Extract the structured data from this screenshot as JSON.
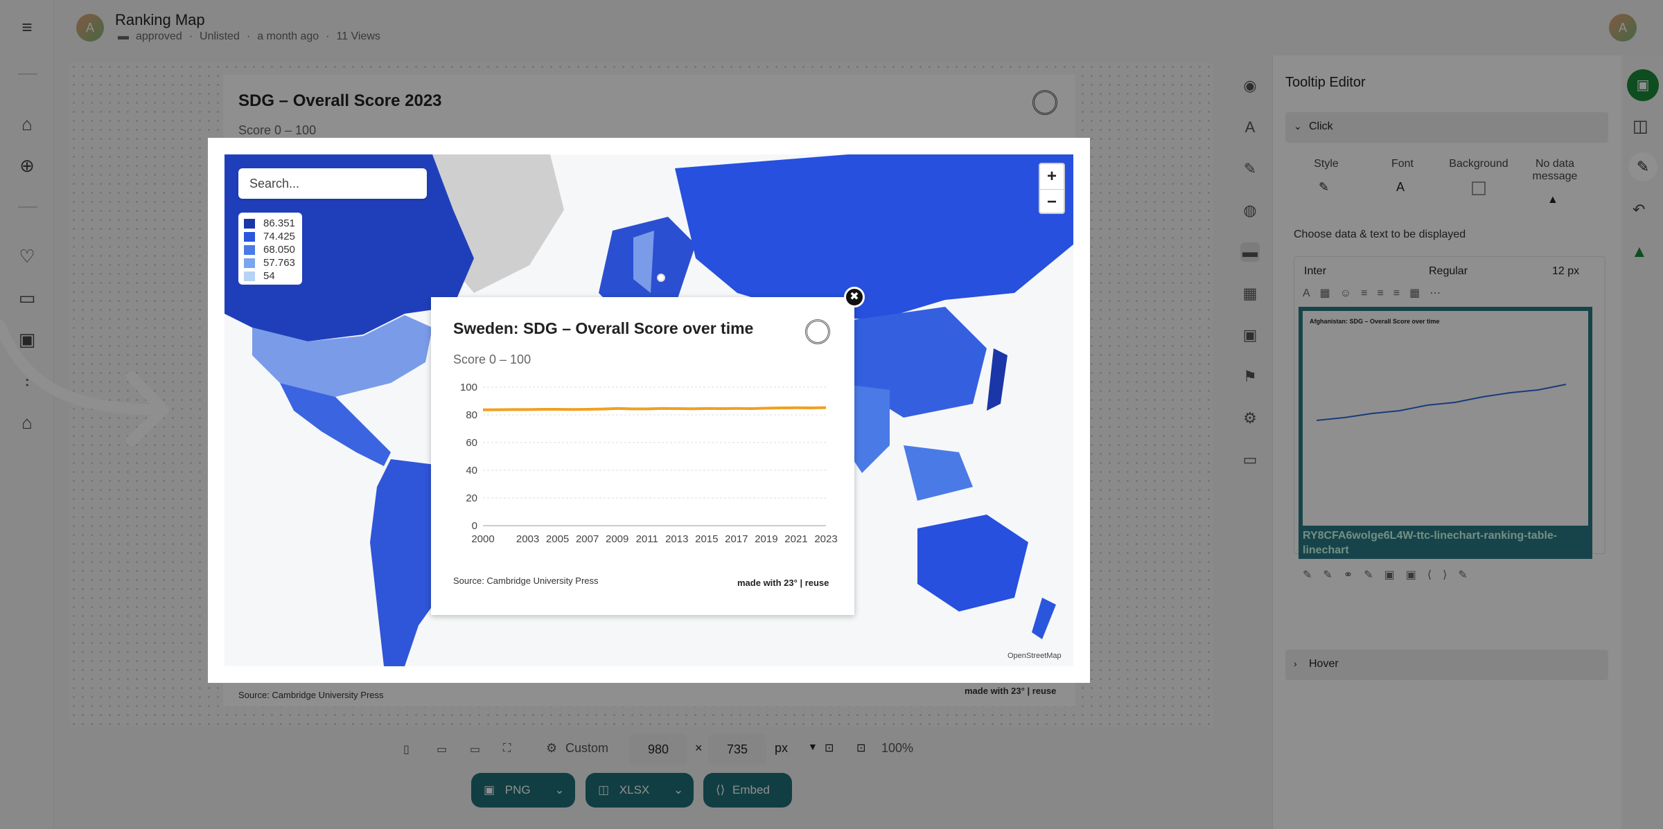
{
  "app": {
    "title": "Ranking Map",
    "folder": "approved",
    "visibility": "Unlisted",
    "time": "a month ago",
    "views": "11 Views",
    "avatar_letter": "A"
  },
  "card": {
    "title": "SDG – Overall Score 2023",
    "subtitle": "Score 0 – 100",
    "source": "Source: Cambridge University Press",
    "made_with": "made with 23° | reuse"
  },
  "map": {
    "search_placeholder": "Search...",
    "zoom_in": "+",
    "zoom_out": "−",
    "attribution": "OpenStreetMap",
    "legend": [
      {
        "label": "86.351",
        "color": "#1a36a8"
      },
      {
        "label": "74.425",
        "color": "#2a55dd"
      },
      {
        "label": "68.050",
        "color": "#4a7ae6"
      },
      {
        "label": "57.763",
        "color": "#7aa6f0"
      },
      {
        "label": "54",
        "color": "#b6d2f6"
      }
    ]
  },
  "tooltip": {
    "title": "Sweden: SDG – Overall Score over time",
    "subtitle": "Score 0 – 100",
    "source": "Source: Cambridge University Press",
    "made_with": "made with 23° | reuse",
    "close": "✖"
  },
  "chart_data": {
    "type": "line",
    "title": "Sweden: SDG – Overall Score over time",
    "subtitle": "Score 0 – 100",
    "x_ticks": [
      "2000",
      "2003",
      "2005",
      "2007",
      "2009",
      "2011",
      "2013",
      "2015",
      "2017",
      "2019",
      "2021",
      "2023"
    ],
    "y_ticks": [
      "100",
      "80",
      "60",
      "40",
      "20",
      "0"
    ],
    "ylim": [
      0,
      100
    ],
    "xlim": [
      2000,
      2023
    ],
    "grid": true,
    "series": [
      {
        "color": "#f0a020",
        "x": [
          2000,
          2001,
          2002,
          2003,
          2004,
          2005,
          2006,
          2007,
          2008,
          2009,
          2010,
          2011,
          2012,
          2013,
          2014,
          2015,
          2016,
          2017,
          2018,
          2019,
          2020,
          2021,
          2022,
          2023
        ],
        "y": [
          83.6,
          83.7,
          83.8,
          83.8,
          84.0,
          84.0,
          83.9,
          84.0,
          84.2,
          84.6,
          84.3,
          84.3,
          84.6,
          84.5,
          84.4,
          84.6,
          84.5,
          84.6,
          84.5,
          84.8,
          85.0,
          85.1,
          85.0,
          85.2
        ]
      }
    ]
  },
  "panel": {
    "title": "Tooltip Editor",
    "section_click": "Click",
    "opt_style": "Style",
    "opt_font": "Font",
    "opt_background": "Background",
    "opt_nodata": "No data message",
    "choose_label": "Choose data & text to be displayed",
    "font_family": "Inter",
    "font_weight": "Regular",
    "font_size": "12 px",
    "preview_title": "Afghanistan: SDG – Overall Score over time",
    "preview_caption": "RY8CFA6wolge6L4W-ttc-linechart-ranking-table-linechart",
    "section_hover": "Hover"
  },
  "toolbar": {
    "size_mode": "Custom",
    "width": "980",
    "times": "×",
    "height": "735",
    "unit": "px",
    "zoom": "100%",
    "png": "PNG",
    "xlsx": "XLSX",
    "embed": "Embed"
  }
}
